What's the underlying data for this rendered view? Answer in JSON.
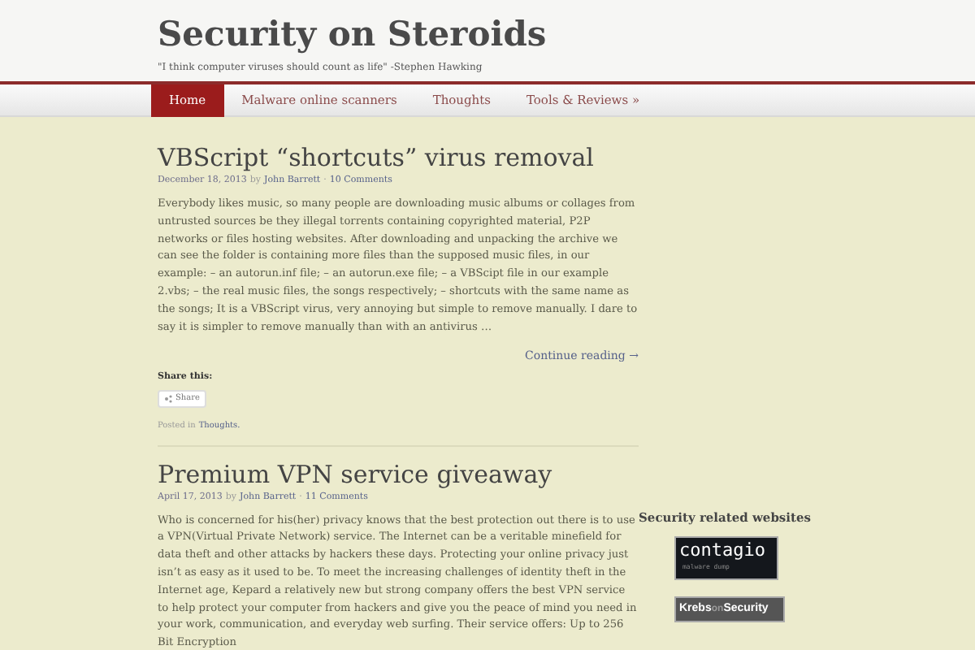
{
  "site": {
    "title": "Security on Steroids",
    "tagline": "\"I think computer viruses should count as life\" -Stephen Hawking"
  },
  "nav": [
    {
      "label": "Home",
      "selected": true
    },
    {
      "label": "Malware online scanners",
      "selected": false
    },
    {
      "label": "Thoughts",
      "selected": false
    },
    {
      "label": "Tools & Reviews »",
      "selected": false
    }
  ],
  "posts": [
    {
      "title": "VBScript “shortcuts” virus removal",
      "date": "December 18, 2013",
      "by": "by",
      "author": "John Barrett",
      "sep": "·",
      "comments": "10 Comments",
      "body": "Everybody likes music, so many people are downloading music albums or collages from untrusted sources be they illegal torrents containing copyrighted material, P2P networks or files hosting websites. After downloading and unpacking the archive we can see the folder is containing more files than the supposed music files, in our example: – an autorun.inf file; – an autorun.exe file; – a VBScipt file in our example 2.vbs; – the real music files, the songs respectively; – shortcuts with the same name as the songs; It is a VBScript virus, very annoying but simple to remove manually. I dare to say it is simpler to remove manually than with an antivirus …",
      "continue": "Continue reading →",
      "share_heading": "Share this:",
      "share_button": "Share",
      "posted_in": "Posted in",
      "category": "Thoughts",
      "category_end": "."
    },
    {
      "title": "Premium VPN service giveaway",
      "date": "April 17, 2013",
      "by": "by",
      "author": "John Barrett",
      "sep": "·",
      "comments": "11 Comments",
      "body": "Who is concerned for his(her) privacy knows that the best protection out there is to use a VPN(Virtual Private Network) service. The Internet can be a veritable minefield for data theft and other attacks by hackers these days. Protecting your online privacy just isn’t as easy as it used to be. To meet the increasing challenges of identity theft in the Internet age, Kepard a relatively new but strong company offers the best VPN service to help protect your computer from hackers and give you the peace of mind you need in your work, communication, and everyday web surfing. Their service offers: Up to 256 Bit Encryption"
    }
  ],
  "sidebar": {
    "heading": "Security related websites",
    "badges": [
      {
        "kind": "contagio",
        "name": "contagio",
        "sub": "malware dump"
      },
      {
        "kind": "krebs",
        "name": "Krebs",
        "mid": "on",
        "end": "Security"
      }
    ]
  }
}
